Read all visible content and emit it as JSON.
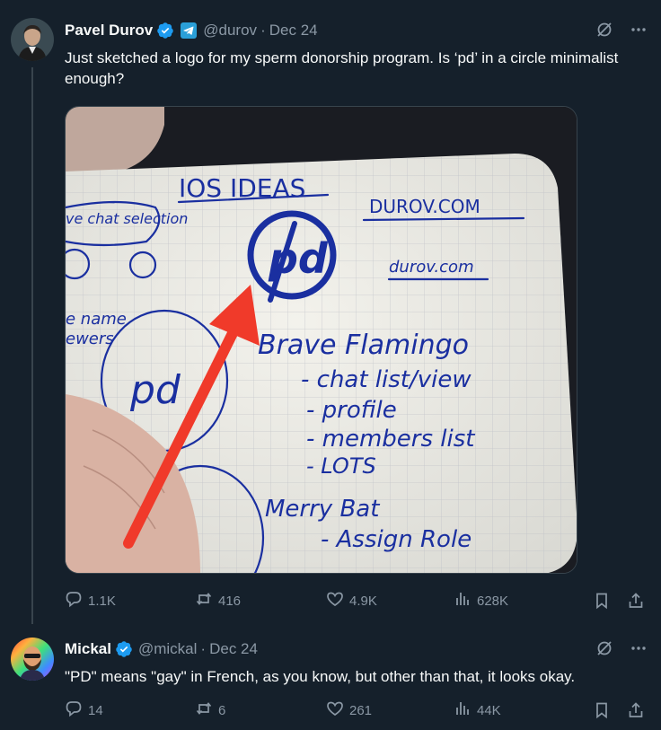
{
  "tweet1": {
    "author": "Pavel Durov",
    "handle": "@durov",
    "separator": "·",
    "date": "Dec 24",
    "text": "Just sketched a logo for my sperm donorship program. Is ‘pd’ in a circle minimalist enough?",
    "stats": {
      "replies": "1.1K",
      "reposts": "416",
      "likes": "4.9K",
      "views": "628K"
    },
    "notebook": {
      "heading": "IOS IDEAS",
      "domain_caps": "DUROV.COM",
      "domain_lower": "durov.com",
      "logo": "pd",
      "list_title": "Brave Flamingo",
      "items": [
        "- chat list/view",
        "- profile",
        "- members list",
        "- LOTS"
      ],
      "list2_title": "Merry Bat",
      "list2_item": "- Assign Role",
      "left_bubble": "ve chat selection",
      "left_note1": "e name",
      "left_note2": "ewers"
    }
  },
  "tweet2": {
    "author": "Mickal",
    "handle": "@mickal",
    "separator": "·",
    "date": "Dec 24",
    "text": "\"PD\" means \"gay\" in French, as you know, but other than that, it looks okay.",
    "stats": {
      "replies": "14",
      "reposts": "6",
      "likes": "261",
      "views": "44K"
    }
  },
  "colors": {
    "background": "#15202b",
    "text": "#f7f9f9",
    "muted": "#8b98a5",
    "verified": "#1d9bf0",
    "divider": "#38444d"
  },
  "icons": [
    "verified-badge-icon",
    "telegram-badge-icon",
    "grok-icon",
    "more-icon",
    "reply-icon",
    "repost-icon",
    "like-icon",
    "views-icon",
    "bookmark-icon",
    "share-icon"
  ]
}
